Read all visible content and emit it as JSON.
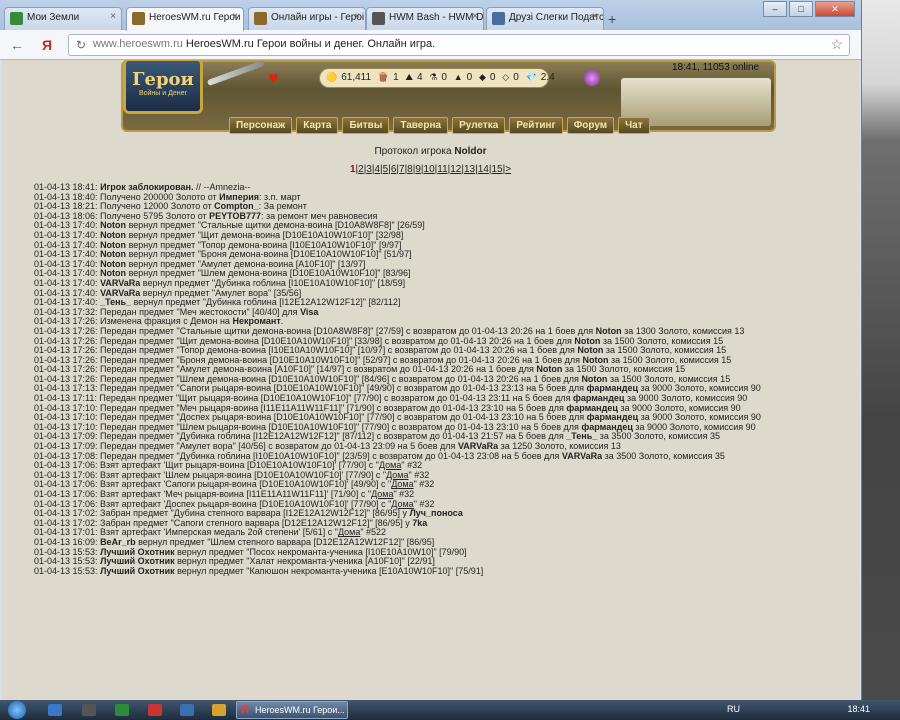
{
  "browser": {
    "tabs": [
      {
        "label": "Мои Земли",
        "icon": "sheet",
        "color": "#3a8a3a"
      },
      {
        "label": "HeroesWM.ru Герои в...",
        "icon": "heroes",
        "color": "#8a6a2a"
      },
      {
        "label": "Онлайн игры - Героi...",
        "icon": "heroes",
        "color": "#8a6a2a"
      },
      {
        "label": "HWM Bash - HWM Da...",
        "icon": "tools",
        "color": "#555"
      },
      {
        "label": "Друзі Слегки Податс...",
        "icon": "vk",
        "color": "#4a6c9a"
      }
    ],
    "new_tab": "+",
    "window_buttons": {
      "minimize": "–",
      "maximize": "□",
      "close": "✕"
    },
    "back": "←",
    "yandex": "Я",
    "url_host": "www.heroeswm.ru",
    "url_title": "HeroesWM.ru Герои войны и денег. Онлайн игра.",
    "star": "☆",
    "reload": "↻"
  },
  "header": {
    "logo_title": "Герои",
    "logo_sub": "Войны и Денег",
    "resources": [
      "61,411",
      "1",
      "4",
      "0",
      "0",
      "0",
      "0",
      "2.4"
    ],
    "online": "18:41, 11053 online",
    "menu": [
      "Персонаж",
      "Карта",
      "Битвы",
      "Таверна",
      "Рулетка",
      "Рейтинг",
      "Форум",
      "Чат"
    ]
  },
  "protocol": {
    "title_prefix": "Протокол игрока ",
    "player": "Noldor",
    "current_page": "1",
    "pages": [
      "2",
      "3",
      "4",
      "5",
      "6",
      "7",
      "8",
      "9",
      "10",
      "11",
      "12",
      "13",
      "14",
      "15"
    ],
    "next": ">"
  },
  "log": [
    [
      [
        "01-04-13 18:41: ",
        0
      ],
      [
        "Игрок заблокирован.",
        1
      ],
      [
        " // --Amnezia--",
        0
      ]
    ],
    [
      [
        "01-04-13 18:40: Получено 200000 Золото от ",
        0
      ],
      [
        "Империя",
        1
      ],
      [
        ": з.п. март",
        0
      ]
    ],
    [
      [
        "01-04-13 18:21: Получено 12000 Золото от ",
        0
      ],
      [
        "Compton_",
        1
      ],
      [
        ": За ремонт",
        0
      ]
    ],
    [
      [
        "01-04-13 18:06: Получено 5795 Золото от ",
        0
      ],
      [
        "PEYTOB777",
        1
      ],
      [
        ": за ремонт меч равновесия",
        0
      ]
    ],
    [
      [
        "01-04-13 17:40: ",
        0
      ],
      [
        "Noton",
        1
      ],
      [
        " вернул предмет \"Стальные щитки демона-воина [D10A8W8F8]\" [26/59]",
        0
      ]
    ],
    [
      [
        "01-04-13 17:40: ",
        0
      ],
      [
        "Noton",
        1
      ],
      [
        " вернул предмет \"Щит демона-воина [D10E10A10W10F10]\" [32/98]",
        0
      ]
    ],
    [
      [
        "01-04-13 17:40: ",
        0
      ],
      [
        "Noton",
        1
      ],
      [
        " вернул предмет \"Топор демона-воина [I10E10A10W10F10]\" [9/97]",
        0
      ]
    ],
    [
      [
        "01-04-13 17:40: ",
        0
      ],
      [
        "Noton",
        1
      ],
      [
        " вернул предмет \"Броня демона-воина [D10E10A10W10F10]\" [51/97]",
        0
      ]
    ],
    [
      [
        "01-04-13 17:40: ",
        0
      ],
      [
        "Noton",
        1
      ],
      [
        " вернул предмет \"Амулет демона-воина [A10F10]\" [13/97]",
        0
      ]
    ],
    [
      [
        "01-04-13 17:40: ",
        0
      ],
      [
        "Noton",
        1
      ],
      [
        " вернул предмет \"Шлем демона-воина [D10E10A10W10F10]\" [83/96]",
        0
      ]
    ],
    [
      [
        "01-04-13 17:40: ",
        0
      ],
      [
        "VARVaRa",
        1
      ],
      [
        " вернул предмет \"Дубинка гоблина [I10E10A10W10F10]\" [18/59]",
        0
      ]
    ],
    [
      [
        "01-04-13 17:40: ",
        0
      ],
      [
        "VARVaRa",
        1
      ],
      [
        " вернул предмет \"Амулет вора\" [35/56]",
        0
      ]
    ],
    [
      [
        "01-04-13 17:40: ",
        0
      ],
      [
        "_Тень_",
        1
      ],
      [
        " вернул предмет \"Дубинка гоблина [I12E12A12W12F12]\" [82/112]",
        0
      ]
    ],
    [
      [
        "01-04-13 17:32: Передан предмет \"Меч жестокости\" [40/40] для ",
        0
      ],
      [
        "Visa",
        1
      ]
    ],
    [
      [
        "01-04-13 17:26: Изменена фракция с Демон на ",
        0
      ],
      [
        "Некромант",
        1
      ],
      [
        ".",
        0
      ]
    ],
    [
      [
        "01-04-13 17:26: Передан предмет \"Стальные щитки демона-воина [D10A8W8F8]\" [27/59] с возвратом до 01-04-13 20:26 на 1 боев для ",
        0
      ],
      [
        "Noton",
        1
      ],
      [
        " за 1300 Золото, комиссия 13",
        0
      ]
    ],
    [
      [
        "01-04-13 17:26: Передан предмет \"Щит демона-воина [D10E10A10W10F10]\" [33/98] с возвратом до 01-04-13 20:26 на 1 боев для ",
        0
      ],
      [
        "Noton",
        1
      ],
      [
        " за 1500 Золото, комиссия 15",
        0
      ]
    ],
    [
      [
        "01-04-13 17:26: Передан предмет \"Топор демона-воина [I10E10A10W10F10]\" [10/97] с возвратом до 01-04-13 20:26 на 1 боев для ",
        0
      ],
      [
        "Noton",
        1
      ],
      [
        " за 1500 Золото, комиссия 15",
        0
      ]
    ],
    [
      [
        "01-04-13 17:26: Передан предмет \"Броня демона-воина [D10E10A10W10F10]\" [52/97] с возвратом до 01-04-13 20:26 на 1 боев для ",
        0
      ],
      [
        "Noton",
        1
      ],
      [
        " за 1500 Золото, комиссия 15",
        0
      ]
    ],
    [
      [
        "01-04-13 17:26: Передан предмет \"Амулет демона-воина [A10F10]\" [14/97] с возвратом до 01-04-13 20:26 на 1 боев для ",
        0
      ],
      [
        "Noton",
        1
      ],
      [
        " за 1500 Золото, комиссия 15",
        0
      ]
    ],
    [
      [
        "01-04-13 17:26: Передан предмет \"Шлем демона-воина [D10E10A10W10F10]\" [84/96] с возвратом до 01-04-13 20:26 на 1 боев для ",
        0
      ],
      [
        "Noton",
        1
      ],
      [
        " за 1500 Золото, комиссия 15",
        0
      ]
    ],
    [
      [
        "01-04-13 17:13: Передан предмет \"Сапоги рыцаря-воина [D10E10A10W10F10]\" [49/90] с возвратом до 01-04-13 23:13 на 5 боев для ",
        0
      ],
      [
        "фармандец",
        1
      ],
      [
        " за 9000 Золото, комиссия 90",
        0
      ]
    ],
    [
      [
        "01-04-13 17:11: Передан предмет \"Щит рыцаря-воина [D10E10A10W10F10]\" [77/90] с возвратом до 01-04-13 23:11 на 5 боев для ",
        0
      ],
      [
        "фармандец",
        1
      ],
      [
        " за 9000 Золото, комиссия 90",
        0
      ]
    ],
    [
      [
        "01-04-13 17:10: Передан предмет \"Меч рыцаря-воина [I11E11A11W11F11]\" [71/90] с возвратом до 01-04-13 23:10 на 5 боев для ",
        0
      ],
      [
        "фармандец",
        1
      ],
      [
        " за 9000 Золото, комиссия 90",
        0
      ]
    ],
    [
      [
        "01-04-13 17:10: Передан предмет \"Доспех рыцаря-воина [D10E10A10W10F10]\" [77/90] с возвратом до 01-04-13 23:10 на 5 боев для ",
        0
      ],
      [
        "фармандец",
        1
      ],
      [
        " за 9000 Золото, комиссия 90",
        0
      ]
    ],
    [
      [
        "01-04-13 17:10: Передан предмет \"Шлем рыцаря-воина [D10E10A10W10F10]\" [77/90] с возвратом до 01-04-13 23:10 на 5 боев для ",
        0
      ],
      [
        "фармандец",
        1
      ],
      [
        " за 9000 Золото, комиссия 90",
        0
      ]
    ],
    [
      [
        "01-04-13 17:09: Передан предмет \"Дубинка гоблина [I12E12A12W12F12]\" [87/112] с возвратом до 01-04-13 21:57 на 5 боев для ",
        0
      ],
      [
        "_Тень_",
        1
      ],
      [
        " за 3500 Золото, комиссия 35",
        0
      ]
    ],
    [
      [
        "01-04-13 17:09: Передан предмет \"Амулет вора\" [40/56] с возвратом до 01-04-13 23:09 на 5 боев для ",
        0
      ],
      [
        "VARVaRa",
        1
      ],
      [
        " за 1250 Золото, комиссия 13",
        0
      ]
    ],
    [
      [
        "01-04-13 17:08: Передан предмет \"Дубинка гоблина [I10E10A10W10F10]\" [23/59] с возвратом до 01-04-13 23:08 на 5 боев для ",
        0
      ],
      [
        "VARVaRa",
        1
      ],
      [
        " за 3500 Золото, комиссия 35",
        0
      ]
    ],
    [
      [
        "01-04-13 17:06: Взят артефакт 'Щит рыцаря-воина [D10E10A10W10F10]' [77/90] с \"",
        0
      ],
      [
        "Дома",
        2
      ],
      [
        "\" #32",
        0
      ]
    ],
    [
      [
        "01-04-13 17:06: Взят артефакт 'Шлем рыцаря-воина [D10E10A10W10F10]' [77/90] с \"",
        0
      ],
      [
        "Дома",
        2
      ],
      [
        "\" #32",
        0
      ]
    ],
    [
      [
        "01-04-13 17:06: Взят артефакт 'Сапоги рыцаря-воина [D10E10A10W10F10]' [49/90] с \"",
        0
      ],
      [
        "Дома",
        2
      ],
      [
        "\" #32",
        0
      ]
    ],
    [
      [
        "01-04-13 17:06: Взят артефакт 'Меч рыцаря-воина [I11E11A11W11F11]' [71/90] с \"",
        0
      ],
      [
        "Дома",
        2
      ],
      [
        "\" #32",
        0
      ]
    ],
    [
      [
        "01-04-13 17:06: Взят артефакт 'Доспех рыцаря-воина [D10E10A10W10F10]' [77/90] с \"",
        0
      ],
      [
        "Дома",
        2
      ],
      [
        "\" #32",
        0
      ]
    ],
    [
      [
        "01-04-13 17:02: Забран предмет \"Дубина степного варвара [I12E12A12W12F12]\" [86/95] у ",
        0
      ],
      [
        "Луч_поноса",
        1
      ]
    ],
    [
      [
        "01-04-13 17:02: Забран предмет \"Сапоги степного варвара [D12E12A12W12F12]\" [86/95] у ",
        0
      ],
      [
        "7ka",
        1
      ]
    ],
    [
      [
        "01-04-13 17:01: Взят артефакт 'Имперская медаль 2ой степени' [5/61] с \"",
        0
      ],
      [
        "Дома",
        2
      ],
      [
        "\" #522",
        0
      ]
    ],
    [
      [
        "01-04-13 16:09: ",
        0
      ],
      [
        "BeAr_rb",
        1
      ],
      [
        " вернул предмет \"Шлем степного варвара [D12E12A12W12F12]\" [86/95]",
        0
      ]
    ],
    [
      [
        "01-04-13 15:53: ",
        0
      ],
      [
        "Лучший Охотник",
        1
      ],
      [
        " вернул предмет \"Посох некроманта-ученика [I10E10A10W10]\" [79/90]",
        0
      ]
    ],
    [
      [
        "01-04-13 15:53: ",
        0
      ],
      [
        "Лучший Охотник",
        1
      ],
      [
        " вернул предмет \"Халат некроманта-ученика [A10F10]\" [22/91]",
        0
      ]
    ],
    [
      [
        "01-04-13 15:53: ",
        0
      ],
      [
        "Лучший Охотник",
        1
      ],
      [
        " вернул предмет \"Капюшон некроманта-ученика [E10A10W10F10]\" [75/91]",
        0
      ]
    ]
  ],
  "taskbar": {
    "task_label": "HeroesWM.ru Герои...",
    "task_icon": "Я",
    "lang": "RU",
    "clock": "18:41"
  }
}
